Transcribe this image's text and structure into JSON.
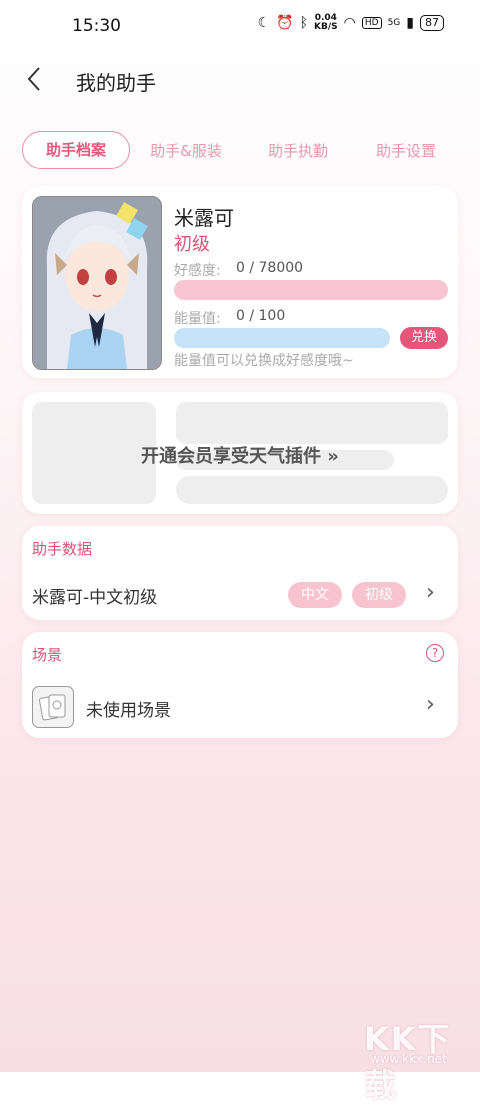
{
  "status_bar": {
    "time": "15:30",
    "net_speed_value": "0.04",
    "net_speed_unit": "KB/S",
    "hd": "HD",
    "signal": "5G",
    "battery": "87"
  },
  "header": {
    "title": "我的助手"
  },
  "tabs": [
    {
      "label": "助手档案",
      "active": true
    },
    {
      "label": "助手&服装",
      "active": false
    },
    {
      "label": "助手执勤",
      "active": false
    },
    {
      "label": "助手设置",
      "active": false
    }
  ],
  "profile": {
    "name": "米露可",
    "level": "初级",
    "favor_label": "好感度:",
    "favor_value": "0 / 78000",
    "favor_progress": 0,
    "energy_label": "能量值:",
    "energy_value": "0 / 100",
    "energy_progress": 0,
    "exchange_label": "兑换",
    "hint": "能量值可以兑换成好感度哦~"
  },
  "weather_plugin": {
    "label": "开通会员享受天气插件 »"
  },
  "assistant_data": {
    "title": "助手数据",
    "item_label": "米露可-中文初级",
    "tags": [
      "中文",
      "初级"
    ]
  },
  "scene": {
    "title": "场景",
    "item_label": "未使用场景"
  },
  "watermark": {
    "logo": "KK下载",
    "url": "www.kkx.net"
  },
  "colors": {
    "accent": "#d8557a",
    "favor_bar": "#f8c6d3",
    "energy_bar": "#c8e2f7",
    "tag_bg": "#f7c3cf"
  }
}
